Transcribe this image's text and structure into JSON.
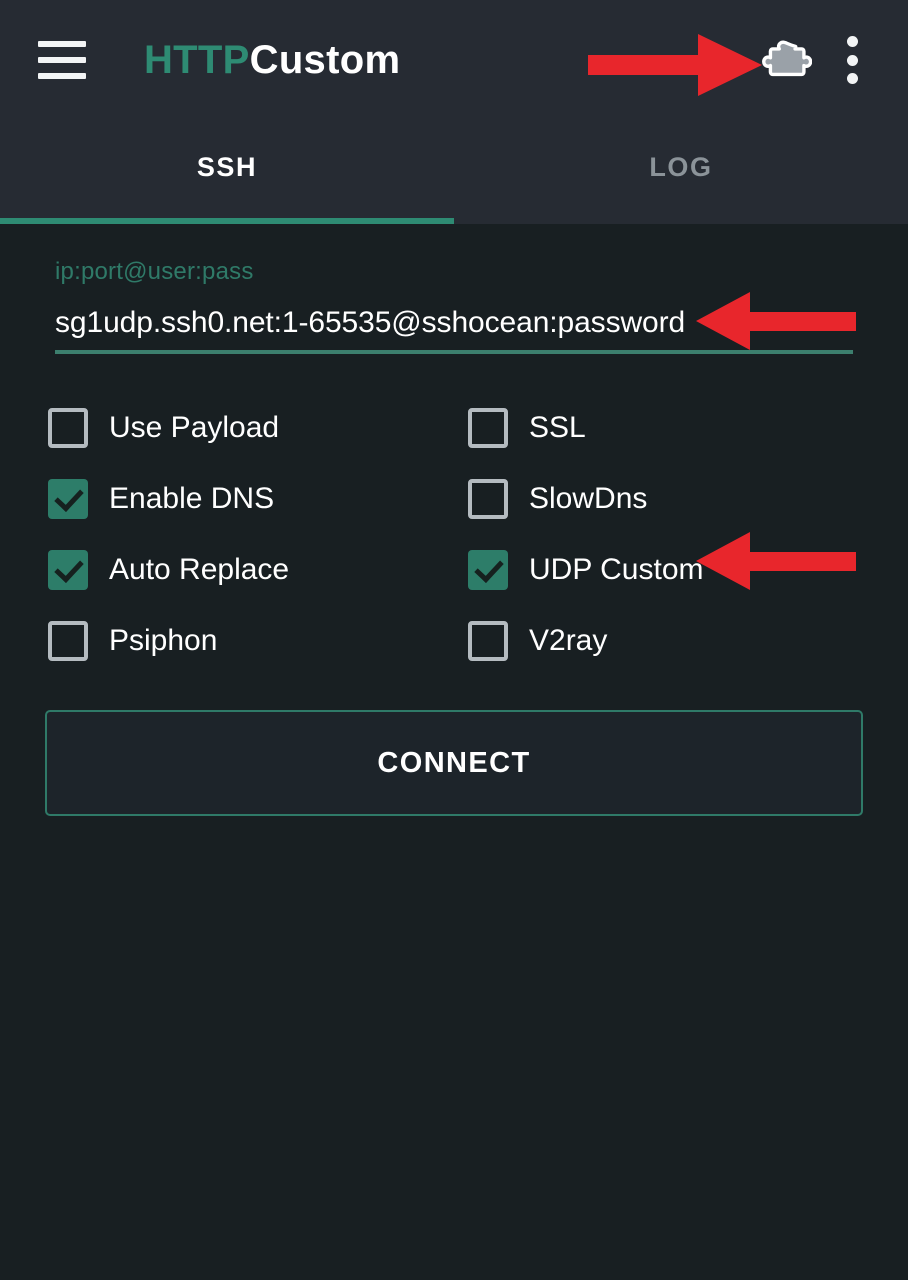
{
  "appbar": {
    "menu_icon": "hamburger-menu-icon",
    "title_primary": "HTTP",
    "title_secondary": "Custom",
    "extension_icon": "puzzle-piece-icon",
    "overflow_icon": "kebab-menu-icon"
  },
  "tabs": [
    {
      "label": "SSH",
      "active": true
    },
    {
      "label": "LOG",
      "active": false
    }
  ],
  "config_field": {
    "label": "ip:port@user:pass",
    "value": "sg1udp.ssh0.net:1-65535@sshocean:password",
    "placeholder": "ip:port@user:pass"
  },
  "options": {
    "left": [
      {
        "label": "Use Payload",
        "checked": false
      },
      {
        "label": "Enable DNS",
        "checked": true
      },
      {
        "label": "Auto Replace",
        "checked": true
      },
      {
        "label": "Psiphon",
        "checked": false
      }
    ],
    "right": [
      {
        "label": "SSL",
        "checked": false
      },
      {
        "label": "SlowDns",
        "checked": false
      },
      {
        "label": "UDP Custom",
        "checked": true
      },
      {
        "label": "V2ray",
        "checked": false
      }
    ]
  },
  "connect_button": {
    "label": "CONNECT"
  },
  "annotations": [
    {
      "name": "arrow-to-extension-icon",
      "direction": "right"
    },
    {
      "name": "arrow-to-config-field",
      "direction": "left"
    },
    {
      "name": "arrow-to-udp-custom",
      "direction": "left"
    }
  ],
  "colors": {
    "accent_teal": "#2e8b73",
    "checkbox_on": "#2d7d69",
    "appbar_bg": "#262b33",
    "body_bg": "#181f22",
    "annotation_red": "#e8262c",
    "text_primary": "#ffffff",
    "text_muted": "#8b9399"
  }
}
